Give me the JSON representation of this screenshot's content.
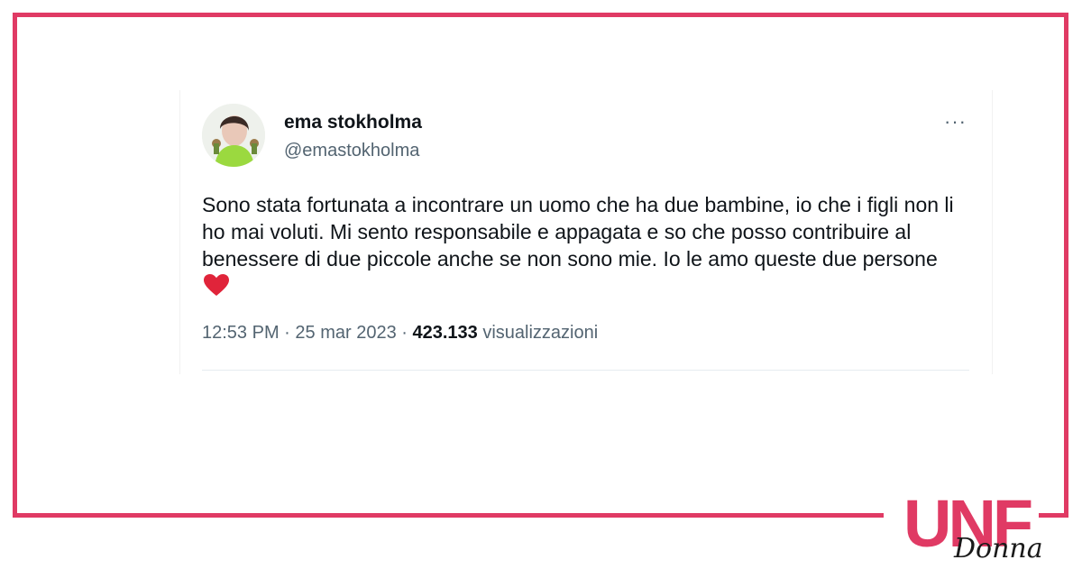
{
  "tweet": {
    "author": {
      "name": "ema stokholma",
      "handle": "@emastokholma"
    },
    "more_label": "···",
    "text": "Sono stata fortunata a incontrare un uomo che ha due bambine, io che i figli non li ho mai voluti. Mi sento responsabile e appagata e so che posso contribuire al benessere di due piccole anche se non sono mie. Io le amo queste due persone",
    "text_emoji": "red-heart-icon",
    "meta": {
      "time": "12:53 PM",
      "separator": "·",
      "date": "25 mar 2023",
      "views_count": "423.133",
      "views_label": "visualizzazioni"
    }
  },
  "brand": {
    "logo_text_top": "UNF",
    "logo_text_script": "Donna",
    "accent_color": "#e03a64"
  }
}
